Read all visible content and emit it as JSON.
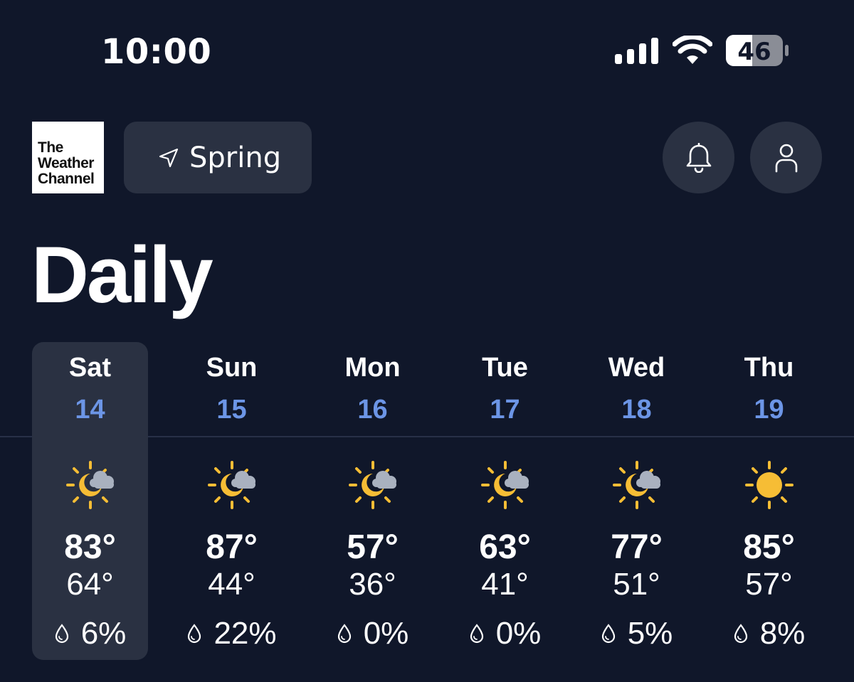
{
  "status_bar": {
    "time": "10:00",
    "battery_level": "46",
    "signal_icon": "cellular-signal-icon",
    "wifi_icon": "wifi-icon"
  },
  "header": {
    "logo_lines": [
      "The",
      "Weather",
      "Channel"
    ],
    "location_label": "Spring",
    "location_icon": "location-arrow-icon",
    "bell_icon": "bell-icon",
    "profile_icon": "person-icon"
  },
  "page_title": "Daily",
  "colors": {
    "background": "#10172a",
    "card": "#2a3142",
    "date_accent": "#6c95e6",
    "sun": "#f6bd35",
    "cloud": "#a9b1bf"
  },
  "days": [
    {
      "name": "Sat",
      "date": "14",
      "icon": "partly-cloudy-night-icon",
      "high": "83°",
      "low": "64°",
      "precip": "6%",
      "selected": true
    },
    {
      "name": "Sun",
      "date": "15",
      "icon": "partly-cloudy-night-icon",
      "high": "87°",
      "low": "44°",
      "precip": "22%",
      "selected": false
    },
    {
      "name": "Mon",
      "date": "16",
      "icon": "partly-cloudy-night-icon",
      "high": "57°",
      "low": "36°",
      "precip": "0%",
      "selected": false
    },
    {
      "name": "Tue",
      "date": "17",
      "icon": "partly-cloudy-night-icon",
      "high": "63°",
      "low": "41°",
      "precip": "0%",
      "selected": false
    },
    {
      "name": "Wed",
      "date": "18",
      "icon": "partly-cloudy-night-icon",
      "high": "77°",
      "low": "51°",
      "precip": "5%",
      "selected": false
    },
    {
      "name": "Thu",
      "date": "19",
      "icon": "sunny-icon",
      "high": "85°",
      "low": "57°",
      "precip": "8%",
      "selected": false
    }
  ]
}
